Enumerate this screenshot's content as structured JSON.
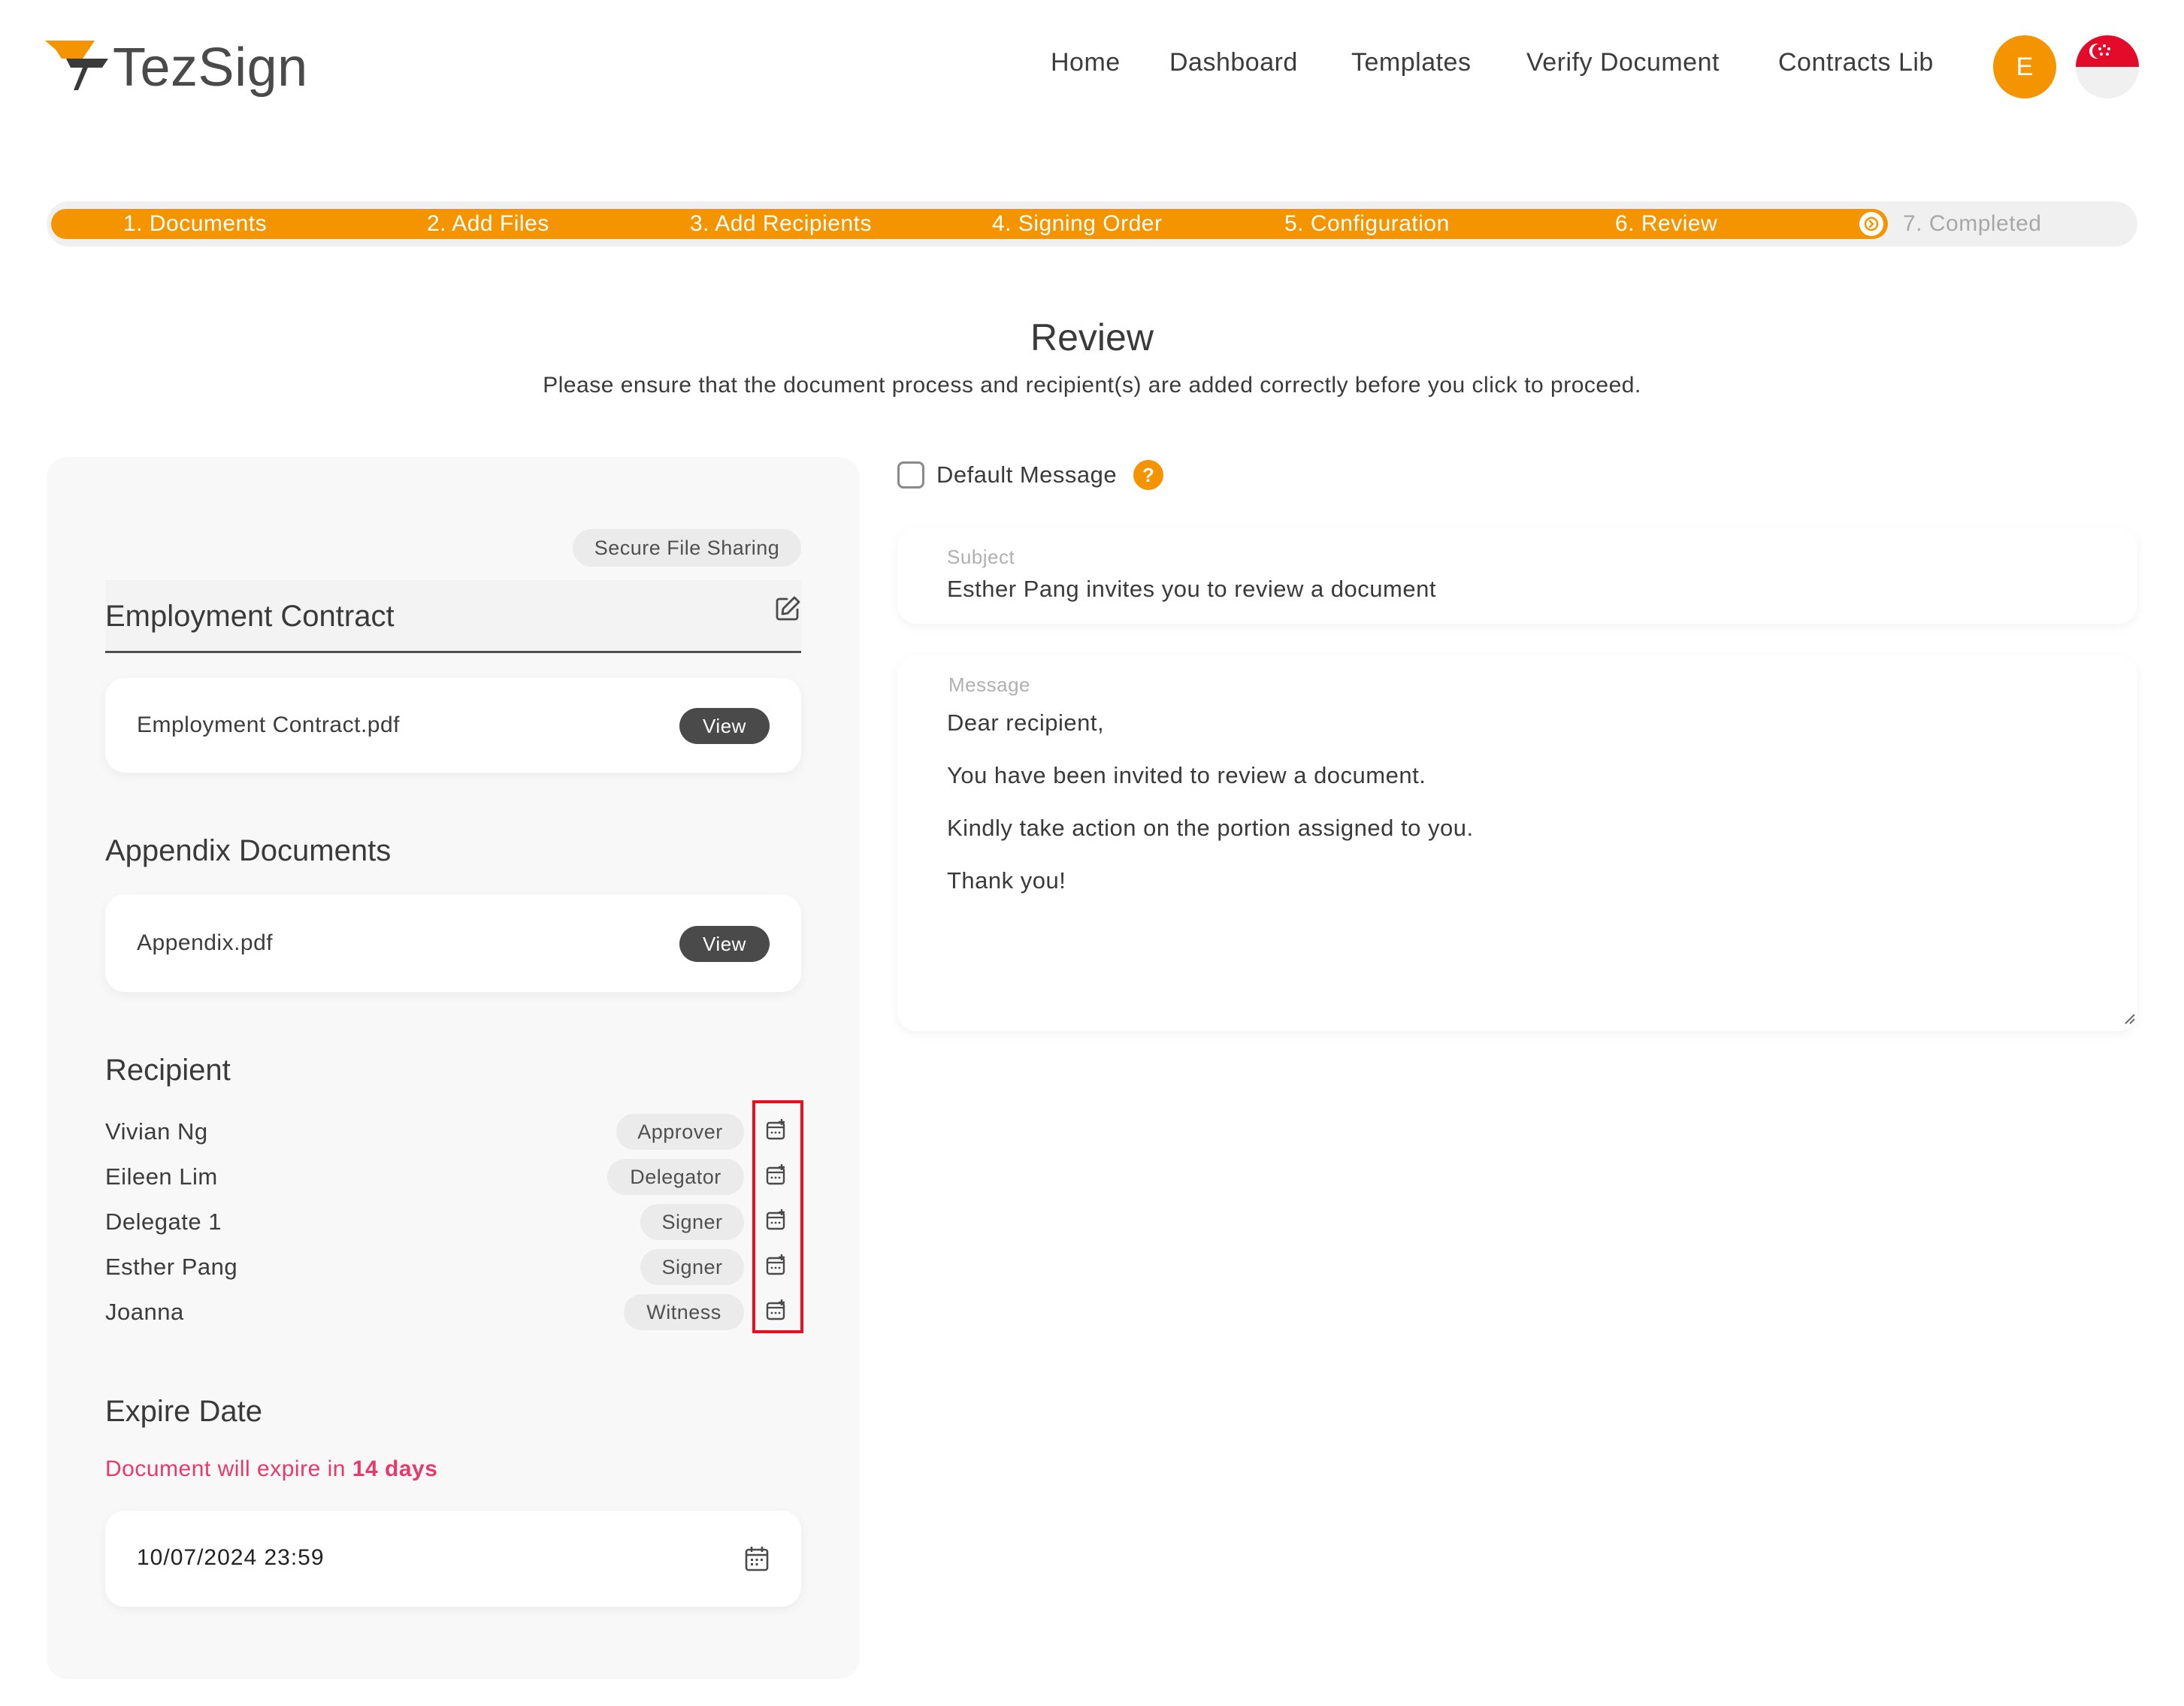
{
  "app": {
    "brand": "TezSign"
  },
  "nav": {
    "items": [
      {
        "label": "Home"
      },
      {
        "label": "Dashboard"
      },
      {
        "label": "Templates"
      },
      {
        "label": "Verify Document"
      },
      {
        "label": "Contracts Lib"
      }
    ],
    "avatar_initial": "E",
    "flag": "singapore-flag-icon"
  },
  "stepper": {
    "steps": [
      {
        "label": "1. Documents",
        "state": "done"
      },
      {
        "label": "2. Add Files",
        "state": "done"
      },
      {
        "label": "3. Add Recipients",
        "state": "done"
      },
      {
        "label": "4. Signing Order",
        "state": "done"
      },
      {
        "label": "5. Configuration",
        "state": "done"
      },
      {
        "label": "6. Review",
        "state": "current"
      },
      {
        "label": "7. Completed",
        "state": "pending"
      }
    ],
    "accent": "#f39400"
  },
  "page": {
    "title": "Review",
    "subtitle": "Please ensure that the document process and recipient(s) are added correctly before you click to proceed."
  },
  "document": {
    "badge": "Secure File Sharing",
    "title": "Employment Contract",
    "file": {
      "name": "Employment Contract.pdf",
      "action": "View"
    }
  },
  "appendix": {
    "heading": "Appendix Documents",
    "file": {
      "name": "Appendix.pdf",
      "action": "View"
    }
  },
  "recipients": {
    "heading": "Recipient",
    "items": [
      {
        "name": "Vivian Ng",
        "role": "Approver"
      },
      {
        "name": "Eileen Lim",
        "role": "Delegator"
      },
      {
        "name": "Delegate 1",
        "role": "Signer"
      },
      {
        "name": "Esther Pang",
        "role": "Signer"
      },
      {
        "name": "Joanna",
        "role": "Witness"
      }
    ]
  },
  "expiry": {
    "heading": "Expire Date",
    "note_prefix": "Document will expire in",
    "note_value": "14 days",
    "date": "10/07/2024 23:59",
    "note_color": "#e53a6a"
  },
  "message": {
    "default_label": "Default Message",
    "default_checked": false,
    "help": "?",
    "subject_label": "Subject",
    "subject_value": "Esther Pang invites you to review a document",
    "message_label": "Message",
    "lines": [
      "Dear recipient,",
      "You have been invited to review a document.",
      "Kindly take action on the portion assigned to you.",
      "Thank you!"
    ]
  }
}
